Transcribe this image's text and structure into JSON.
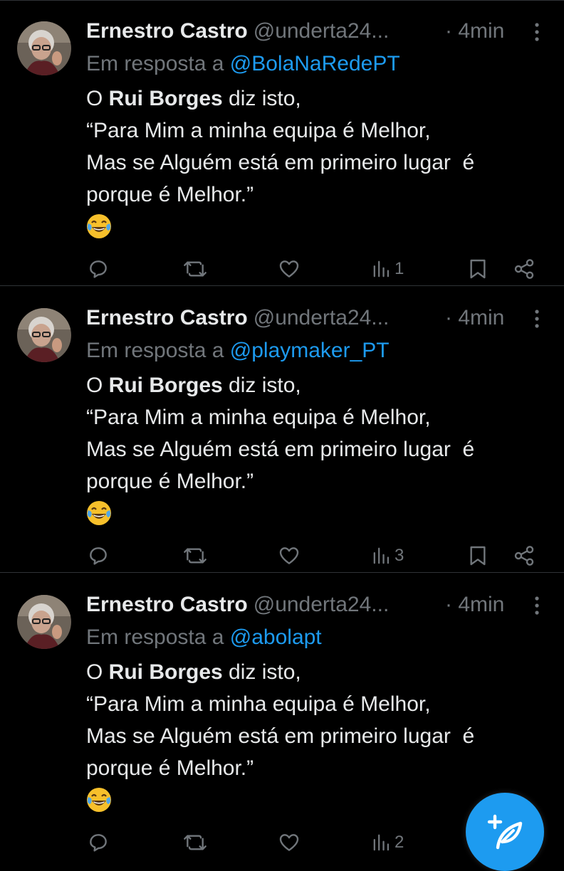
{
  "colors": {
    "background": "#000000",
    "text": "#e7e9ea",
    "muted": "#71767b",
    "link": "#1d9bf0",
    "divider": "#2f3336",
    "fab": "#1d9bf0"
  },
  "tweets": [
    {
      "author_name": "Ernestro Castro",
      "author_handle": "@underta24...",
      "time": "· 4min",
      "reply_prefix": "Em resposta a ",
      "reply_mention": "@BolaNaRedePT",
      "text_line1_pre": "O ",
      "text_line1_bold": "Rui Borges",
      "text_line1_post": " diz isto,",
      "text_line2": "“Para Mim a minha equipa é Melhor,",
      "text_line3": "Mas se Alguém está em primeiro lugar  é",
      "text_line4": "porque é Melhor.”",
      "emoji": "face-with-tears-of-joy",
      "views": "1"
    },
    {
      "author_name": "Ernestro Castro",
      "author_handle": "@underta24...",
      "time": "· 4min",
      "reply_prefix": "Em resposta a ",
      "reply_mention": "@playmaker_PT",
      "text_line1_pre": "O ",
      "text_line1_bold": "Rui Borges",
      "text_line1_post": " diz isto,",
      "text_line2": "“Para Mim a minha equipa é Melhor,",
      "text_line3": "Mas se Alguém está em primeiro lugar  é",
      "text_line4": "porque é Melhor.”",
      "emoji": "face-with-tears-of-joy",
      "views": "3"
    },
    {
      "author_name": "Ernestro Castro",
      "author_handle": "@underta24...",
      "time": "· 4min",
      "reply_prefix": "Em resposta a ",
      "reply_mention": "@abolapt",
      "text_line1_pre": "O ",
      "text_line1_bold": "Rui Borges",
      "text_line1_post": " diz isto,",
      "text_line2": "“Para Mim a minha equipa é Melhor,",
      "text_line3": "Mas se Alguém está em primeiro lugar  é",
      "text_line4": "porque é Melhor.”",
      "emoji": "face-with-tears-of-joy",
      "views": "2"
    }
  ],
  "fab": {
    "icon": "compose-post-icon"
  }
}
